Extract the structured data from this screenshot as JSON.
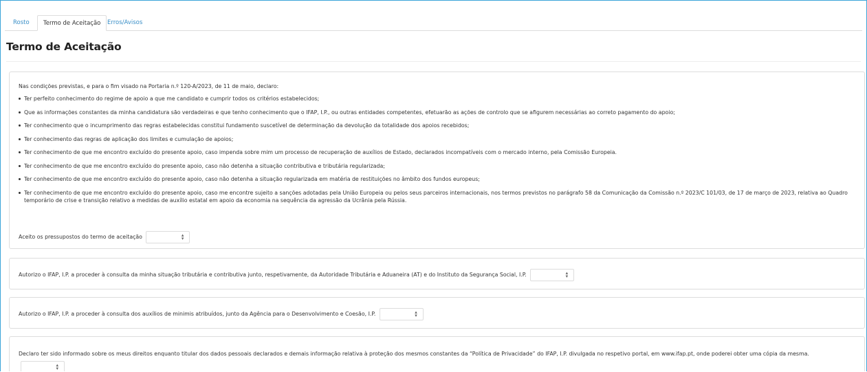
{
  "tabs": [
    {
      "label": "Rosto",
      "active": false
    },
    {
      "label": "Termo de Aceitação",
      "active": true
    },
    {
      "label": "Erros/Avisos",
      "active": false
    }
  ],
  "page_title": "Termo de Aceitação",
  "terms": {
    "intro": "Nas condições previstas, e para o fim visado na Portaria n.º 120-A/2023, de 11 de maio, declaro:",
    "items": [
      "Ter perfeito conhecimento do regime de apoio a que me candidato e cumprir todos os critérios estabelecidos;",
      "Que as informações constantes da minha candidatura são verdadeiras e que tenho conhecimento que o IFAP, I.P., ou outras entidades competentes, efetuarão as ações de controlo que se afigurem necessárias ao correto pagamento do apoio;",
      "Ter conhecimento que o incumprimento das regras estabelecidas constitui fundamento suscetível de determinação da devolução da totalidade dos apoios recebidos;",
      "Ter conhecimento das regras de aplicação dos limites e cumulação de apoios;",
      "Ter conhecimento de que me encontro excluído do presente apoio, caso impenda sobre mim um processo de recuperação de auxílios de Estado, declarados incompatíveis com o mercado interno, pela Comissão Europeia.",
      "Ter conhecimento de que me encontro excluído do presente apoio, caso não detenha a situação contributiva e tributária regularizada;",
      "Ter conhecimento de que me encontro excluído do presente apoio, caso não detenha a situação regularizada em matéria de restituições no âmbito dos fundos europeus;",
      "Ter conhecimento de que me encontro excluído do presente apoio, caso me encontre sujeito a sanções adotadas pela União Europeia ou pelos seus parceiros internacionais, nos termos previstos no parágrafo 58 da Comunicação da Comissão n.º 2023/C 101/03, de 17 de março de 2023, relativa ao Quadro temporário de crise e transição relativo a medidas de auxílio estatal em apoio da economia na sequência da agressão da Ucrânia pela Rússia."
    ],
    "accept_label": "Aceito os pressupostos do termo de aceitação",
    "accept_value": ""
  },
  "consent_tax": {
    "label": "Autorizo o IFAP, I.P. a proceder à consulta da minha situação tributária e contributiva junto, respetivamente, da Autoridade Tributária e Aduaneira (AT) e do Instituto da Segurança Social, I.P.",
    "value": ""
  },
  "consent_minimis": {
    "label": "Autorizo o IFAP, I.P. a proceder à consulta dos auxílios de minimis atribuídos, junto da Agência para o Desenvolvimento e Coesão, I.P.",
    "value": ""
  },
  "privacy": {
    "label": "Declaro ter sido informado sobre os meus direitos enquanto titular dos dados pessoais declarados e demais informação relativa à proteção dos mesmos constantes da “Política de Privacidade” do IFAP, I.P. divulgada no respetivo portal, em www.ifap.pt, onde poderei obter uma cópia da mesma.",
    "value": ""
  },
  "colors": {
    "frame_border": "#3aa3d9",
    "link": "#3a8fc7",
    "panel_border": "#dddddd"
  }
}
